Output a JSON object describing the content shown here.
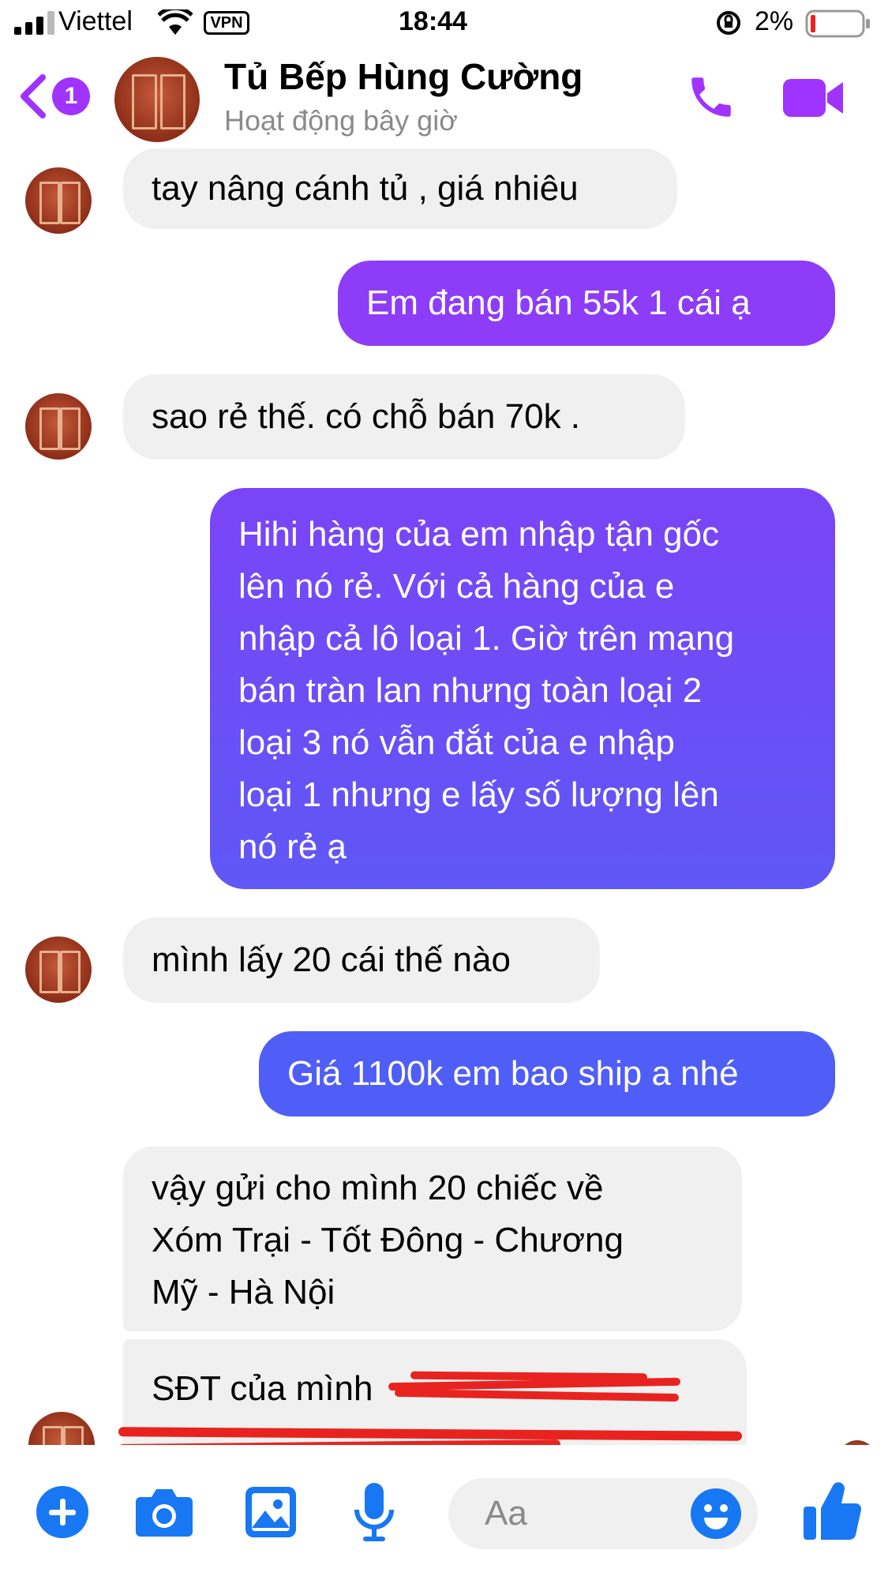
{
  "status_bar": {
    "carrier": "Viettel",
    "vpn": "VPN",
    "time": "18:44",
    "battery": "2%"
  },
  "header": {
    "back_badge": "1",
    "contact_name": "Tủ Bếp Hùng Cường",
    "active_status": "Hoạt động bây giờ"
  },
  "messages": [
    {
      "side": "in",
      "text": "tay nâng cánh tủ , giá nhiêu"
    },
    {
      "side": "out",
      "text": "Em đang bán 55k 1 cái ạ"
    },
    {
      "side": "in",
      "text": "sao rẻ thế. có chỗ bán 70k ."
    },
    {
      "side": "out",
      "lines": [
        "Hihi hàng của em nhập tận gốc",
        "lên nó rẻ. Với cả hàng của e",
        "nhập cả lô loại 1. Giờ trên mạng",
        "bán tràn lan nhưng toàn loại 2",
        "loại 3 nó vẫn đắt của e nhập",
        "loại 1 nhưng e lấy số lượng lên",
        "nó rẻ ạ"
      ]
    },
    {
      "side": "in",
      "text": "mình lấy 20 cái thế nào"
    },
    {
      "side": "out",
      "text": "Giá 1100k em bao ship a nhé"
    },
    {
      "side": "in",
      "lines": [
        "vậy gửi cho mình 20 chiếc về",
        "Xóm Trại - Tốt Đông - Chương",
        "Mỹ - Hà Nội"
      ]
    },
    {
      "side": "in",
      "text": "SĐT của mình"
    }
  ],
  "composer": {
    "placeholder": "Aa"
  },
  "colors": {
    "accent": "#a033ff",
    "bubble_out_1": "#8d3cf7",
    "bubble_out_2": "#6a4df7",
    "bubble_out_3": "#4f5ef6",
    "bubble_in": "#f0f0f0",
    "toolbar_icon": "#1877f2",
    "redaction": "#e8231f"
  }
}
